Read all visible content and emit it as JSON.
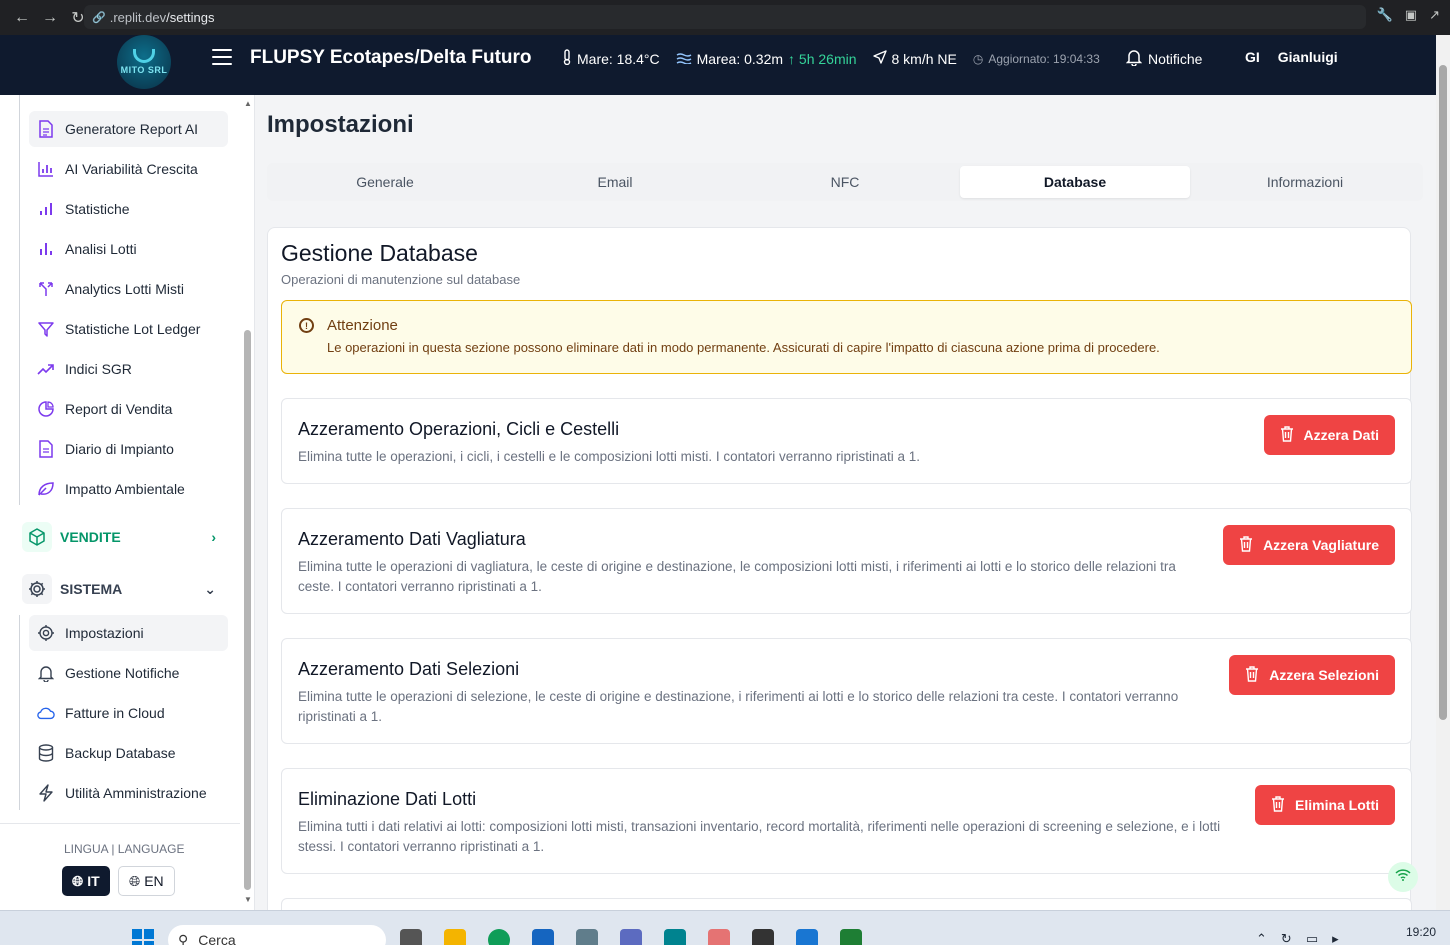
{
  "browser": {
    "url_prefix": ".replit.dev",
    "url_path": "/settings"
  },
  "header": {
    "logo_text": "MITO SRL",
    "title": "FLUPSY Ecotapes/Delta Futuro",
    "sea_temp": "Mare: 18.4°C",
    "tide": "Marea: 0.32m",
    "tide_trend": "↑ 5h 26min",
    "wind": "8 km/h NE",
    "updated": "Aggiornato: 19:04:33",
    "notifications_label": "Notifiche",
    "user_initials": "GI",
    "user_name": "Gianluigi"
  },
  "sidebar": {
    "items_top": [
      {
        "label": "Generatore Report AI",
        "icon": "report-doc-icon",
        "active": true
      },
      {
        "label": "AI Variabilità Crescita",
        "icon": "bar-chart-icon"
      },
      {
        "label": "Statistiche",
        "icon": "bar-chart-icon"
      },
      {
        "label": "Analisi Lotti",
        "icon": "bar-chart-icon"
      },
      {
        "label": "Analytics Lotti Misti",
        "icon": "split-icon"
      },
      {
        "label": "Statistiche Lot Ledger",
        "icon": "funnel-icon"
      },
      {
        "label": "Indici SGR",
        "icon": "trending-up-icon"
      },
      {
        "label": "Report di Vendita",
        "icon": "pie-chart-icon"
      },
      {
        "label": "Diario di Impianto",
        "icon": "document-icon"
      },
      {
        "label": "Impatto Ambientale",
        "icon": "leaf-icon"
      }
    ],
    "section_sales": "VENDITE",
    "section_system": "SISTEMA",
    "items_system": [
      {
        "label": "Impostazioni",
        "icon": "gear-icon",
        "active": true
      },
      {
        "label": "Gestione Notifiche",
        "icon": "bell-icon"
      },
      {
        "label": "Fatture in Cloud",
        "icon": "cloud-icon"
      },
      {
        "label": "Backup Database",
        "icon": "database-icon"
      },
      {
        "label": "Utilità Amministrazione",
        "icon": "bolt-icon"
      }
    ],
    "language_label": "LINGUA | LANGUAGE",
    "lang_it": "IT",
    "lang_en": "EN"
  },
  "page": {
    "title": "Impostazioni",
    "tabs": [
      "Generale",
      "Email",
      "NFC",
      "Database",
      "Informazioni"
    ],
    "active_tab": "Database",
    "card_title": "Gestione Database",
    "card_subtitle": "Operazioni di manutenzione sul database",
    "alert_title": "Attenzione",
    "alert_text": "Le operazioni in questa sezione possono eliminare dati in modo permanente. Assicurati di capire l'impatto di ciascuna azione prima di procedere.",
    "operations": [
      {
        "title": "Azzeramento Operazioni, Cicli e Cestelli",
        "desc": "Elimina tutte le operazioni, i cicli, i cestelli e le composizioni lotti misti. I contatori verranno ripristinati a 1.",
        "button": "Azzera Dati"
      },
      {
        "title": "Azzeramento Dati Vagliatura",
        "desc": "Elimina tutte le operazioni di vagliatura, le ceste di origine e destinazione, le composizioni lotti misti, i riferimenti ai lotti e lo storico delle relazioni tra ceste. I contatori verranno ripristinati a 1.",
        "button": "Azzera Vagliature"
      },
      {
        "title": "Azzeramento Dati Selezioni",
        "desc": "Elimina tutte le operazioni di selezione, le ceste di origine e destinazione, i riferimenti ai lotti e lo storico delle relazioni tra ceste. I contatori verranno ripristinati a 1.",
        "button": "Azzera Selezioni"
      },
      {
        "title": "Eliminazione Dati Lotti",
        "desc": "Elimina tutti i dati relativi ai lotti: composizioni lotti misti, transazioni inventario, record mortalità, riferimenti nelle operazioni di screening e selezione, e i lotti stessi. I contatori verranno ripristinati a 1.",
        "button": "Elimina Lotti"
      }
    ]
  },
  "taskbar": {
    "search_placeholder": "Cerca",
    "time": "19:20"
  },
  "colors": {
    "header_bg": "#0f1a2e",
    "accent_purple": "#7c3aed",
    "danger": "#ef4444",
    "sales_green": "#059669"
  }
}
